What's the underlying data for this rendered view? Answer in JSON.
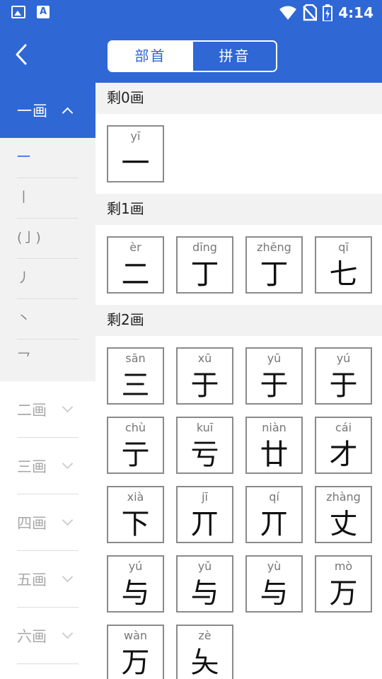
{
  "status_bar": {
    "time": "4:14",
    "left_icons": [
      "image-icon",
      "a-letter-icon"
    ],
    "right_icons": [
      "wifi-icon",
      "no-sim-icon",
      "battery-charging-icon"
    ]
  },
  "header": {
    "tabs": [
      {
        "label": "部首",
        "active": true
      },
      {
        "label": "拼音",
        "active": false
      }
    ]
  },
  "sidebar": {
    "active_group": {
      "label": "一画"
    },
    "sub_items": [
      {
        "label": "一",
        "selected": true
      },
      {
        "label": "丨",
        "selected": false
      },
      {
        "label": "(亅)",
        "selected": false
      },
      {
        "label": "丿",
        "selected": false
      },
      {
        "label": "丶",
        "selected": false
      },
      {
        "label": "乛",
        "selected": false
      }
    ],
    "groups": [
      "二画",
      "三画",
      "四画",
      "五画",
      "六画"
    ]
  },
  "sections": [
    {
      "title": "剩0画",
      "chars": [
        {
          "py": "yī",
          "hz": "一"
        }
      ]
    },
    {
      "title": "剩1画",
      "chars": [
        {
          "py": "èr",
          "hz": "二"
        },
        {
          "py": "dīng",
          "hz": "丁"
        },
        {
          "py": "zhēng",
          "hz": "丁"
        },
        {
          "py": "qī",
          "hz": "七"
        }
      ]
    },
    {
      "title": "剩2画",
      "chars": [
        {
          "py": "sān",
          "hz": "三"
        },
        {
          "py": "xū",
          "hz": "于"
        },
        {
          "py": "yū",
          "hz": "于"
        },
        {
          "py": "yú",
          "hz": "于"
        },
        {
          "py": "chù",
          "hz": "亍"
        },
        {
          "py": "kuī",
          "hz": "亏"
        },
        {
          "py": "niàn",
          "hz": "廿"
        },
        {
          "py": "cái",
          "hz": "才"
        },
        {
          "py": "xià",
          "hz": "下"
        },
        {
          "py": "jī",
          "hz": "丌"
        },
        {
          "py": "qí",
          "hz": "丌"
        },
        {
          "py": "zhàng",
          "hz": "丈"
        },
        {
          "py": "yú",
          "hz": "与"
        },
        {
          "py": "yǔ",
          "hz": "与"
        },
        {
          "py": "yù",
          "hz": "与"
        },
        {
          "py": "mò",
          "hz": "万"
        },
        {
          "py": "wàn",
          "hz": "万"
        },
        {
          "py": "zè",
          "hz": "夨"
        }
      ]
    }
  ],
  "colors": {
    "primary": "#2f67d5",
    "card_border": "#8a8a8a"
  }
}
